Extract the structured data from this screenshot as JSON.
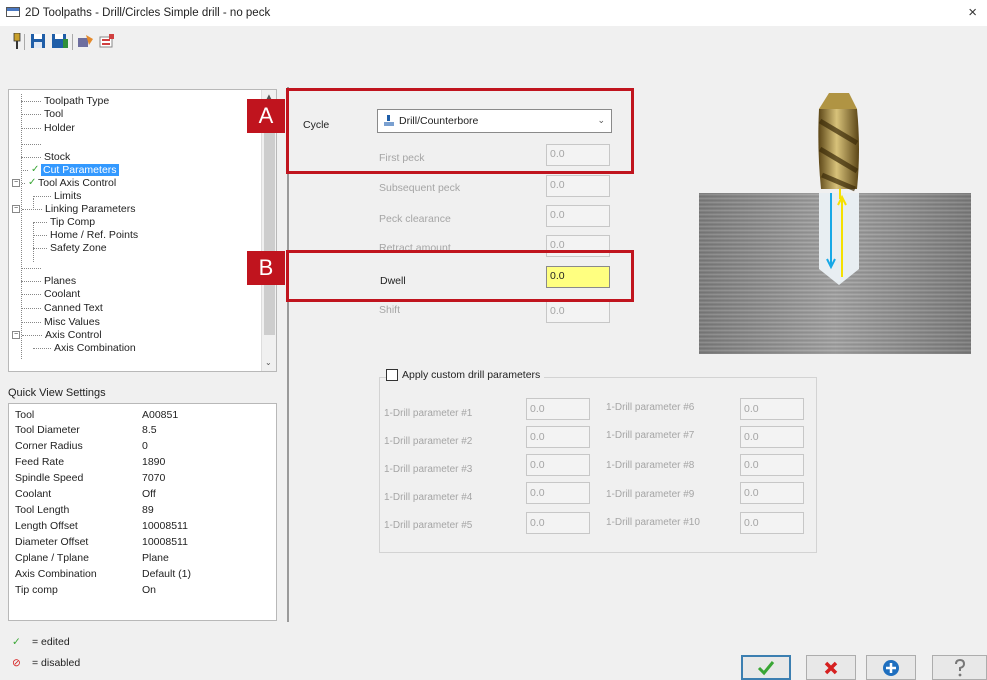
{
  "window": {
    "title": "2D Toolpaths - Drill/Circles Simple drill - no peck",
    "close_glyph": "×"
  },
  "toolbar": {
    "icons": [
      "tool-pin-icon",
      "save-icon",
      "save-library-icon",
      "operation-defaults-icon",
      "edit-list-icon"
    ]
  },
  "tree": {
    "items": [
      {
        "label": "Toolpath Type",
        "edited": false
      },
      {
        "label": "Tool",
        "edited": false
      },
      {
        "label": "Holder",
        "edited": false
      },
      {
        "label": "Stock",
        "edited": false
      },
      {
        "label": "Cut Parameters",
        "edited": true,
        "selected": true
      },
      {
        "label": "Tool Axis Control",
        "edited": true,
        "expandable": true
      },
      {
        "label": "Limits",
        "edited": false
      },
      {
        "label": "Linking Parameters",
        "edited": false,
        "expandable": true
      },
      {
        "label": "Tip Comp",
        "edited": false
      },
      {
        "label": "Home / Ref. Points",
        "edited": false
      },
      {
        "label": "Safety Zone",
        "edited": false
      },
      {
        "label": "Planes",
        "edited": false
      },
      {
        "label": "Coolant",
        "edited": false
      },
      {
        "label": "Canned Text",
        "edited": false
      },
      {
        "label": "Misc Values",
        "edited": false
      },
      {
        "label": "Axis Control",
        "edited": false,
        "expandable": true
      },
      {
        "label": "Axis Combination",
        "edited": false
      }
    ]
  },
  "quick_view": {
    "title": "Quick View Settings",
    "rows": [
      {
        "key": "Tool",
        "value": "A00851"
      },
      {
        "key": "Tool Diameter",
        "value": "8.5"
      },
      {
        "key": "Corner Radius",
        "value": "0"
      },
      {
        "key": "Feed Rate",
        "value": "1890"
      },
      {
        "key": "Spindle Speed",
        "value": "7070"
      },
      {
        "key": "Coolant",
        "value": "Off"
      },
      {
        "key": "Tool Length",
        "value": "89"
      },
      {
        "key": "Length Offset",
        "value": "10008511"
      },
      {
        "key": "Diameter Offset",
        "value": "10008511"
      },
      {
        "key": "Cplane / Tplane",
        "value": "Plane"
      },
      {
        "key": "Axis Combination",
        "value": "Default (1)"
      },
      {
        "key": "Tip comp",
        "value": "On"
      }
    ]
  },
  "legend": {
    "edited": "= edited",
    "disabled": "= disabled",
    "edited_color": "#3aa635",
    "disabled_color": "#d62020"
  },
  "cut_params": {
    "cycle_label": "Cycle",
    "cycle_value": "Drill/Counterbore",
    "first_peck_label": "First peck",
    "first_peck_value": "0.0",
    "subsequent_peck_label": "Subsequent peck",
    "subsequent_peck_value": "0.0",
    "peck_clearance_label": "Peck clearance",
    "peck_clearance_value": "0.0",
    "retract_amount_label": "Retract amount",
    "retract_amount_value": "0.0",
    "dwell_label": "Dwell",
    "dwell_value": "0.0",
    "shift_label": "Shift",
    "shift_value": "0.0"
  },
  "callouts": {
    "a": "A",
    "b": "B",
    "color": "#c0141e"
  },
  "custom_drill": {
    "checkbox_label": "Apply custom drill parameters",
    "checked": false,
    "params": [
      {
        "label": "1-Drill parameter #1",
        "value": "0.0"
      },
      {
        "label": "1-Drill parameter #2",
        "value": "0.0"
      },
      {
        "label": "1-Drill parameter #3",
        "value": "0.0"
      },
      {
        "label": "1-Drill parameter #4",
        "value": "0.0"
      },
      {
        "label": "1-Drill parameter #5",
        "value": "0.0"
      },
      {
        "label": "1-Drill parameter #6",
        "value": "0.0"
      },
      {
        "label": "1-Drill parameter #7",
        "value": "0.0"
      },
      {
        "label": "1-Drill parameter #8",
        "value": "0.0"
      },
      {
        "label": "1-Drill parameter #9",
        "value": "0.0"
      },
      {
        "label": "1-Drill parameter #10",
        "value": "0.0"
      }
    ]
  },
  "buttons": {
    "ok_icon": "checkmark-icon",
    "cancel_icon": "x-icon",
    "add_icon": "plus-circle-icon",
    "help_icon": "question-icon"
  }
}
